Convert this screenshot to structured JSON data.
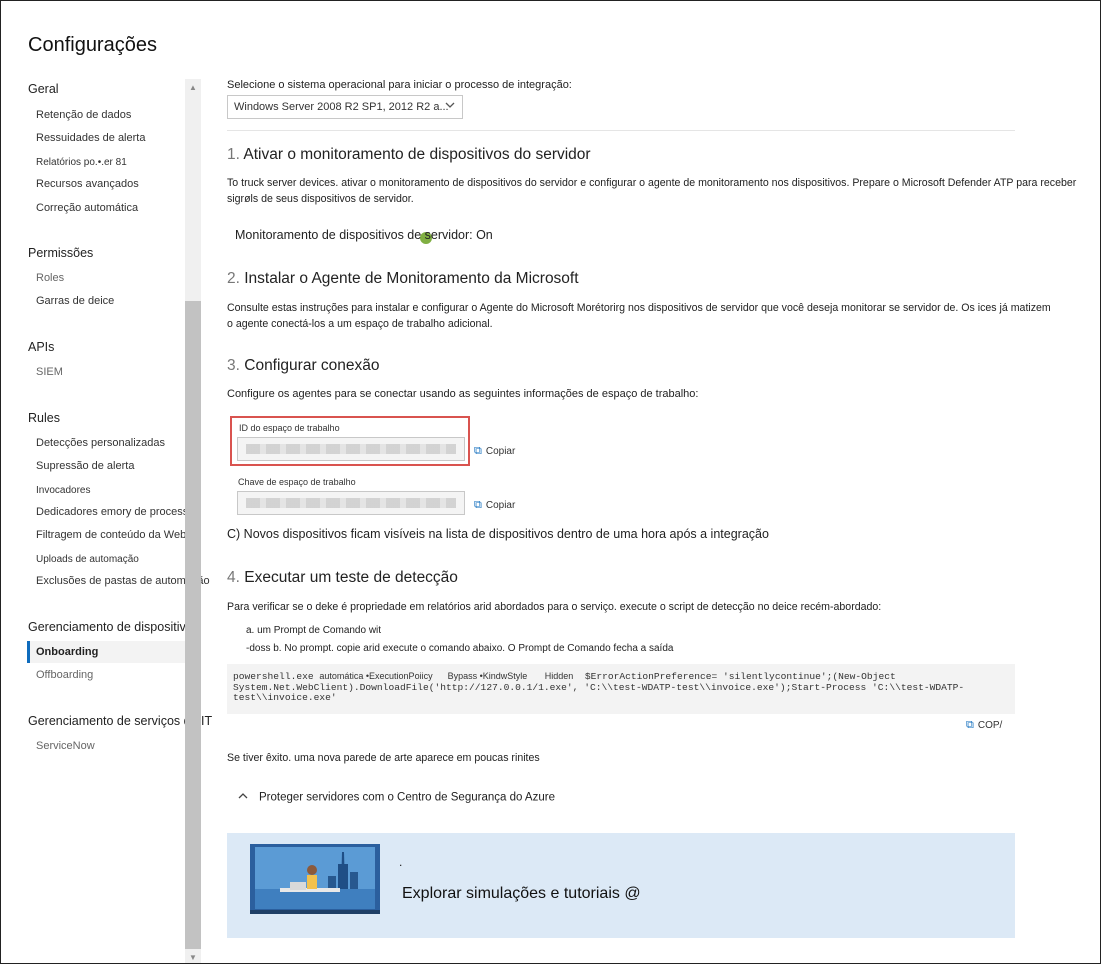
{
  "page": {
    "title": "Configurações"
  },
  "sidebar": {
    "sections": [
      {
        "header": "Geral",
        "items": [
          "Retenção de dados",
          "Ressuidades de alerta",
          "Relatórios po.•.er 81",
          "Recursos avançados",
          "Correção automática"
        ]
      },
      {
        "header": "Permissões",
        "items": [
          "Roles",
          "Garras de deice"
        ]
      },
      {
        "header": "APIs",
        "items": [
          "SIEM"
        ]
      },
      {
        "header": "Rules",
        "items": [
          "Detecções personalizadas",
          "Supressão de alerta",
          "Invocadores",
          "Dedicadores emory de processo",
          "Filtragem de conteúdo da Web",
          "Uploads de automação",
          "Exclusões de pastas de automação"
        ]
      },
      {
        "header": "Gerenciamento de dispositivos",
        "items": [
          "Onboarding",
          "Offboarding"
        ]
      },
      {
        "header": "Gerenciamento de serviços de IT",
        "items": [
          "ServiceNow"
        ]
      }
    ],
    "active_item": "Onboarding"
  },
  "main": {
    "os_prompt": "Selecione o sistema operacional para iniciar o processo de integração:",
    "os_select_value": "Windows Server 2008 R2 SP1, 2012 R2 a...",
    "step1": {
      "num": "1.",
      "title": "Ativar o monitoramento de dispositivos do servidor",
      "desc_line1": "To truck server devices. ativar o monitoramento de dispositivos do servidor e configurar o agente de monitoramento nos dispositivos. Prepare o Microsoft Defender ATP para receber",
      "desc_line2": "sigrøls de seus dispositivos de servidor.",
      "status": "Monitoramento de dispositivos de servidor: On"
    },
    "step2": {
      "num": "2.",
      "title": "Instalar o Agente de Monitoramento da Microsoft",
      "desc_line1": "Consulte estas instruções para instalar e configurar o Agente do Microsoft Morétorirg nos dispositivos de servidor que você deseja monitorar se servidor de. Os ices já matizem",
      "desc_line2": "o agente conectá-los a um espaço de trabalho adicional."
    },
    "step3": {
      "num": "3.",
      "title": "Configurar conexão",
      "desc": "Configure os agentes para se conectar usando as seguintes informações de espaço de trabalho:",
      "workspace_id_label": "ID do espaço de trabalho",
      "workspace_key_label": "Chave de espaço de trabalho",
      "copy_label": "Copiar",
      "note": "C) Novos dispositivos ficam visíveis na lista de dispositivos dentro de uma hora após a integração"
    },
    "step4": {
      "num": "4.",
      "title": "Executar um teste de detecção",
      "desc": "Para verificar se o deke é propriedade em relatórios arid abordados para o serviço. execute o script de detecção no deice recém-abordado:",
      "sub_a": "a. um Prompt de Comando wit",
      "sub_b": "-doss b. No prompt. copie arid execute o comando abaixo. O Prompt de Comando fecha a saída",
      "code_line1_a": "powershell.exe ",
      "code_line1_b": "automática •ExecutionPoiicy",
      "code_line1_c": "      Bypass •KindwStyle",
      "code_line1_d": "       Hidden",
      "code_line1_e": "  $ErrorActionPreference= 'silentlycontinue';(New-Object",
      "code_line2": "System.Net.WebClient).DownloadFile('http://127.0.0.1/1.exe', 'C:\\\\test-WDATP-test\\\\invoice.exe');Start-Process 'C:\\\\test-WDATP-",
      "code_line3": "test\\\\invoice.exe'",
      "copy_label": "COP/",
      "success": "Se tiver êxito. uma nova parede de arte aparece em poucas rinites"
    },
    "azure_toggle": "Proteger servidores com o Centro de Segurança do Azure",
    "banner": {
      "dot": ".",
      "text": "Explorar simulações e tutoriais @"
    }
  },
  "colors": {
    "accent": "#0f6cbd",
    "highlight": "#d9534f",
    "banner_bg": "#dce9f6"
  },
  "icons": [
    "chevron-down-icon",
    "copy-icon",
    "chevron-up-icon",
    "scroll-up-icon",
    "scroll-down-icon"
  ]
}
